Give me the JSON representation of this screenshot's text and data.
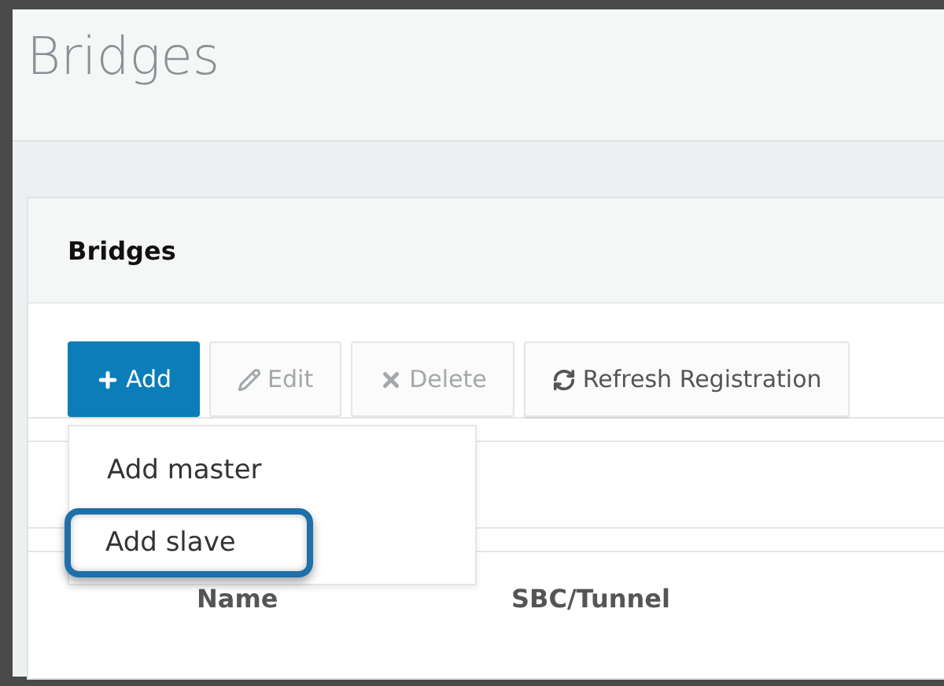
{
  "page": {
    "title": "Bridges"
  },
  "card": {
    "title": "Bridges"
  },
  "toolbar": [
    {
      "kind": "add",
      "label": "Add",
      "disabled": false
    },
    {
      "kind": "edit",
      "label": "Edit",
      "disabled": true
    },
    {
      "kind": "delete",
      "label": "Delete",
      "disabled": true
    },
    {
      "kind": "refresh",
      "label": "Refresh Registration",
      "disabled": false
    }
  ],
  "add_menu": {
    "items": [
      {
        "label": "Add master",
        "selected": false
      },
      {
        "label": "Add slave",
        "selected": true
      }
    ]
  },
  "table": {
    "columns": [
      "Name",
      "SBC/Tunnel"
    ]
  }
}
